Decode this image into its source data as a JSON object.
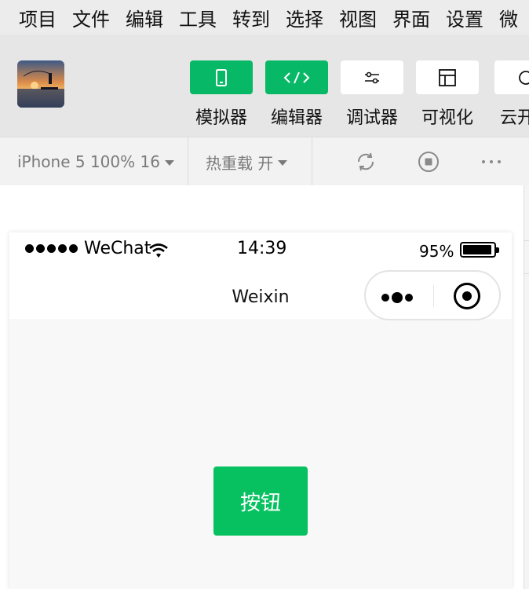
{
  "menu": [
    "项目",
    "文件",
    "编辑",
    "工具",
    "转到",
    "选择",
    "视图",
    "界面",
    "设置",
    "微"
  ],
  "toolbar": {
    "tools": [
      {
        "label": "模拟器",
        "icon": "phone-icon",
        "active": true
      },
      {
        "label": "编辑器",
        "icon": "code-icon",
        "active": true
      },
      {
        "label": "调试器",
        "icon": "sliders-icon",
        "active": false
      },
      {
        "label": "可视化",
        "icon": "layout-icon",
        "active": false
      },
      {
        "label": "云开发",
        "icon": "cloud-icon",
        "active": false
      }
    ]
  },
  "subbar": {
    "device": "iPhone 5 100% 16",
    "hot_reload": "热重载 开"
  },
  "phone": {
    "carrier": "WeChat",
    "time": "14:39",
    "battery": "95%",
    "battery_level": 0.95,
    "nav_title": "Weixin",
    "button_label": "按钮"
  },
  "colors": {
    "accent_green": "#07c160",
    "toolbar_green": "#07b966"
  }
}
